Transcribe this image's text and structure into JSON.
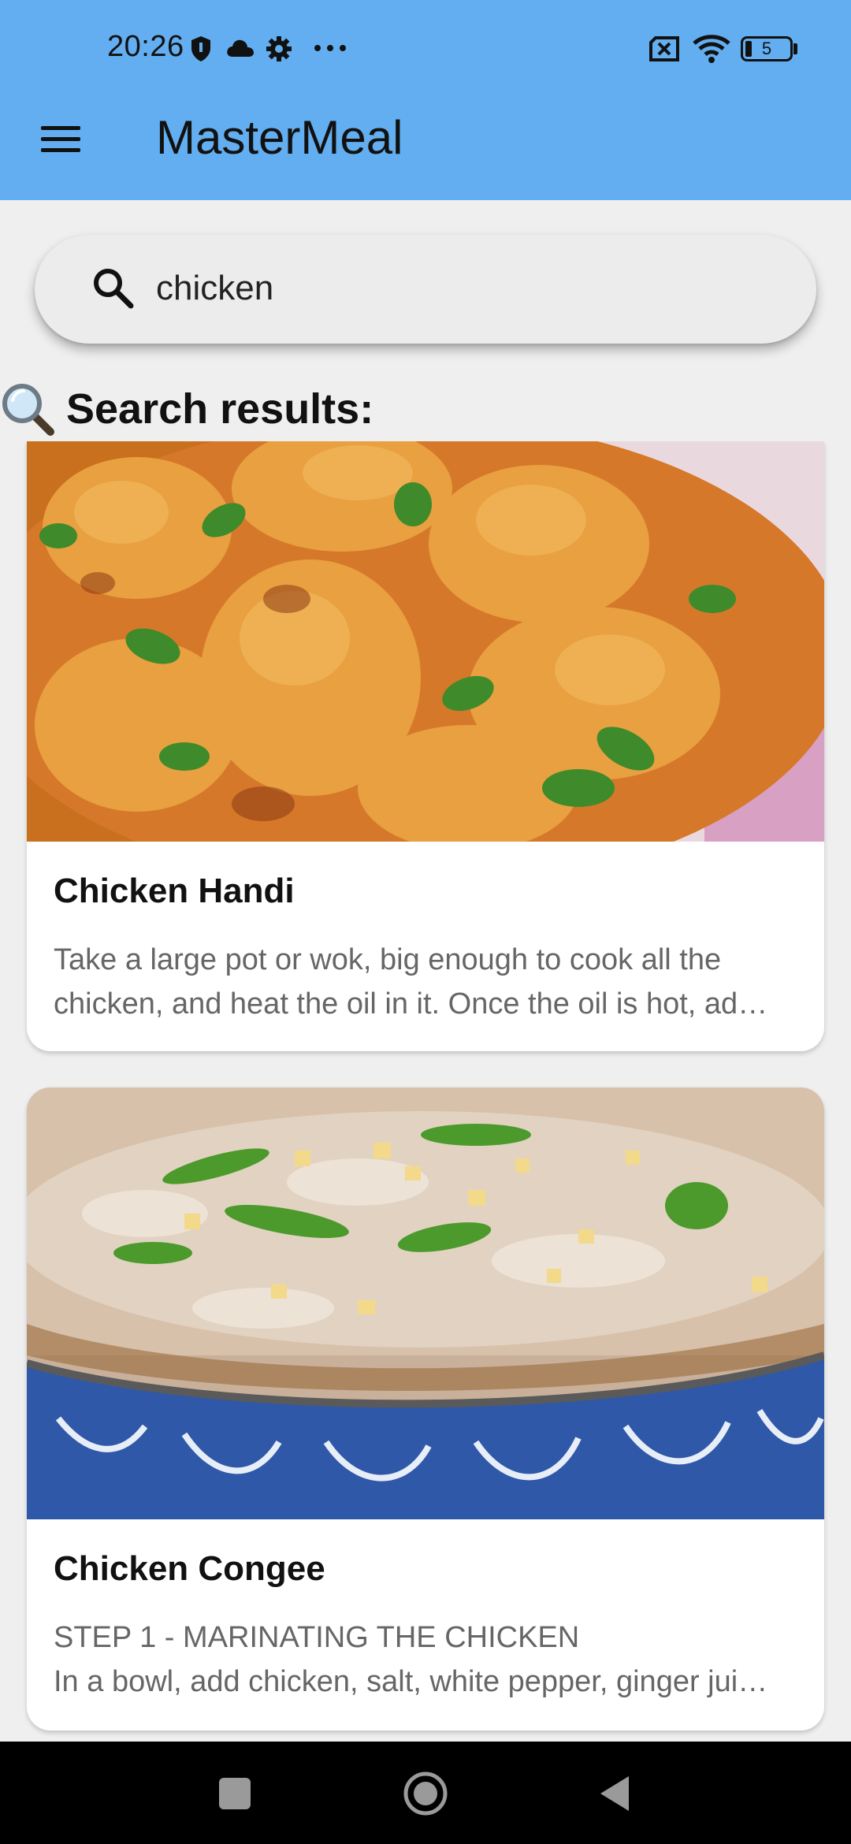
{
  "status_bar": {
    "time": "20:26",
    "left_icons": [
      "shield-icon",
      "cloud-icon",
      "gear-icon",
      "more-dots-icon"
    ],
    "battery_level": "5",
    "right_icons": [
      "sim-off-icon",
      "wifi-icon",
      "battery-icon"
    ]
  },
  "app_bar": {
    "title": "MasterMeal",
    "menu_icon": "hamburger-menu-icon",
    "background_color": "#62aef0"
  },
  "search": {
    "value": "chicken",
    "icon": "search-icon"
  },
  "results": {
    "heading": "Search results:",
    "heading_icon": "magnifying-glass-emoji-icon",
    "items": [
      {
        "title": "Chicken Handi",
        "description_lines": [
          "Take a large pot or wok, big enough to cook all the",
          "chicken, and heat the oil in it.  Once the oil is hot, ad…"
        ]
      },
      {
        "title": "Chicken Congee",
        "description_lines": [
          "STEP 1 - MARINATING THE CHICKEN",
          "In a bowl, add chicken, salt, white pepper, ginger jui…"
        ]
      }
    ]
  },
  "nav_bar": {
    "buttons": [
      "recents-square-icon",
      "home-circle-icon",
      "back-triangle-icon"
    ]
  }
}
